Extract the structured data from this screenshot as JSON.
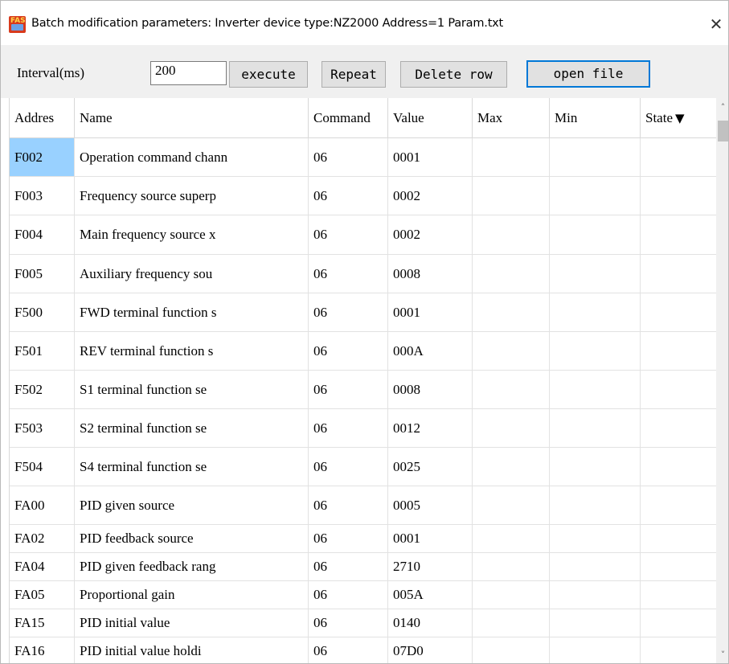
{
  "window": {
    "title": "Batch modification parameters: Inverter device type:NZ2000  Address=1  Param.txt",
    "close_glyph": "✕",
    "icon_text": "FAS"
  },
  "toolbar": {
    "interval_label": "Interval(ms)",
    "interval_value": "200",
    "execute_label": "execute",
    "repeat_label": "Repeat",
    "delete_row_label": "Delete row",
    "open_file_label": "open file"
  },
  "table": {
    "columns": [
      "Addres",
      "Name",
      "Command",
      "Value",
      "Max",
      "Min",
      "State"
    ],
    "sort_indicator": "▼",
    "rows": [
      {
        "address": "F002",
        "name": "Operation command chann",
        "command": "06",
        "value": "0001",
        "max": "",
        "min": "",
        "state": ""
      },
      {
        "address": "F003",
        "name": "Frequency source superp",
        "command": "06",
        "value": "0002",
        "max": "",
        "min": "",
        "state": ""
      },
      {
        "address": "F004",
        "name": "Main frequency source x",
        "command": "06",
        "value": "0002",
        "max": "",
        "min": "",
        "state": ""
      },
      {
        "address": "F005",
        "name": "Auxiliary frequency sou",
        "command": "06",
        "value": "0008",
        "max": "",
        "min": "",
        "state": ""
      },
      {
        "address": "F500",
        "name": "FWD terminal function s",
        "command": "06",
        "value": "0001",
        "max": "",
        "min": "",
        "state": ""
      },
      {
        "address": "F501",
        "name": "REV terminal function s",
        "command": "06",
        "value": "000A",
        "max": "",
        "min": "",
        "state": ""
      },
      {
        "address": "F502",
        "name": "S1 terminal function se",
        "command": "06",
        "value": "0008",
        "max": "",
        "min": "",
        "state": ""
      },
      {
        "address": "F503",
        "name": "S2 terminal function se",
        "command": "06",
        "value": "0012",
        "max": "",
        "min": "",
        "state": ""
      },
      {
        "address": "F504",
        "name": "S4 terminal function se",
        "command": "06",
        "value": "0025",
        "max": "",
        "min": "",
        "state": ""
      },
      {
        "address": "FA00",
        "name": "PID given source",
        "command": "06",
        "value": "0005",
        "max": "",
        "min": "",
        "state": ""
      },
      {
        "address": "FA02",
        "name": "PID feedback source",
        "command": "06",
        "value": "0001",
        "max": "",
        "min": "",
        "state": ""
      },
      {
        "address": "FA04",
        "name": "PID given feedback rang",
        "command": "06",
        "value": "2710",
        "max": "",
        "min": "",
        "state": ""
      },
      {
        "address": "FA05",
        "name": "Proportional gain",
        "command": "06",
        "value": "005A",
        "max": "",
        "min": "",
        "state": ""
      },
      {
        "address": "FA15",
        "name": "PID initial value",
        "command": "06",
        "value": "0140",
        "max": "",
        "min": "",
        "state": ""
      },
      {
        "address": "FA16",
        "name": "PID initial value holdi",
        "command": "06",
        "value": "07D0",
        "max": "",
        "min": "",
        "state": ""
      }
    ]
  },
  "scrollbar": {
    "up_glyph": "˄",
    "down_glyph": "˅"
  }
}
